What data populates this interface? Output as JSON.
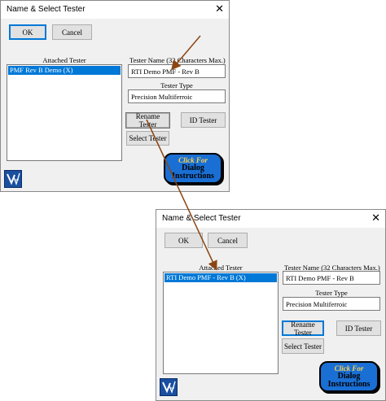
{
  "dialog1": {
    "title": "Name & Select Tester",
    "close": "✕",
    "ok_label": "OK",
    "cancel_label": "Cancel",
    "attached_tester_label": "Attached Tester",
    "attached_items": [
      "PMF Rev B Demo (X)"
    ],
    "tester_name_label": "Tester Name (32 Characters Max.)",
    "tester_name_value": "RTI Demo PMF - Rev B",
    "tester_type_label": "Tester Type",
    "tester_type_value": "Precision Multiferroic",
    "rename_label": "Rename Tester",
    "id_label": "ID Tester",
    "select_label": "Select Tester",
    "help_top": "Click For",
    "help_bot1": "Dialog",
    "help_bot2": "Instructions"
  },
  "dialog2": {
    "title": "Name & Select Tester",
    "close": "✕",
    "ok_label": "OK",
    "cancel_label": "Cancel",
    "attached_tester_label": "Attached Tester",
    "attached_items": [
      "RTI Demo PMF - Rev B (X)"
    ],
    "tester_name_label": "Tester Name (32 Characters Max.)",
    "tester_name_value": "RTI Demo PMF - Rev B",
    "tester_type_label": "Tester Type",
    "tester_type_value": "Precision Multiferroic",
    "rename_label": "Rename Tester",
    "id_label": "ID Tester",
    "select_label": "Select Tester",
    "help_top": "Click For",
    "help_bot1": "Dialog",
    "help_bot2": "Instructions"
  },
  "colors": {
    "arrow": "#8b4513",
    "selection": "#0078d7",
    "help_bg": "#1a6fd4"
  },
  "icons": {
    "logo": "vision-logo-icon",
    "arrow": "annotation-arrow"
  }
}
